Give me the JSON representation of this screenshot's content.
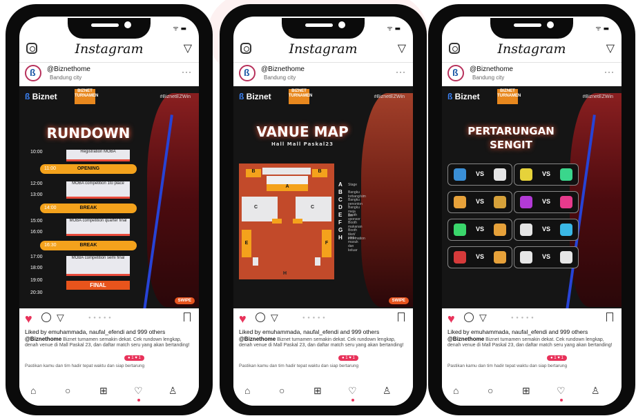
{
  "phones": [
    {
      "brand": "Instagram",
      "username": "@Biznethome",
      "location": "Bandung city",
      "post": {
        "logo": "Biznet",
        "tournament_badge": "BIZNET TURNAMEN",
        "hashtag": "#BiznetEZWin",
        "title": "RUNDOWN",
        "swipe": "SWIPE",
        "schedule": [
          {
            "time": "10:00",
            "label": "Registration MOBA",
            "kind": "box"
          },
          {
            "time": "11:00",
            "label": "OPENING",
            "kind": "bar"
          },
          {
            "time": "12:00",
            "label": "MOBA competition 1to place",
            "kind": "box"
          },
          {
            "time": "13:00",
            "label": "",
            "kind": "time"
          },
          {
            "time": "14:00",
            "label": "BREAK",
            "kind": "bar"
          },
          {
            "time": "15:00",
            "label": "MOBA competition quarter final",
            "kind": "box"
          },
          {
            "time": "16:00",
            "label": "",
            "kind": "time"
          },
          {
            "time": "16:30",
            "label": "BREAK",
            "kind": "bar"
          },
          {
            "time": "17:00",
            "label": "MOBA competition semi final",
            "kind": "box"
          },
          {
            "time": "18:00",
            "label": "",
            "kind": "time"
          },
          {
            "time": "19:00",
            "label": "",
            "kind": "time"
          },
          {
            "time": "20:30",
            "label": "FINAL",
            "kind": "final"
          }
        ]
      },
      "likes": "Liked by emuhammada, naufal_efendi and 999 others",
      "caption_user": "@Biznethome",
      "caption_text": "Biznet turnamen semakin dekat. Cek rundown lengkap, denah venue di Mall Paskal 23, dan daftar match seru yang akan bertanding!",
      "notif": "● 1  ♥  1",
      "comment": "Pastikan kamu dan tim hadir tepat waktu dan siap bertarung"
    },
    {
      "brand": "Instagram",
      "username": "@Biznethome",
      "location": "Bandung city",
      "post": {
        "logo": "Biznet",
        "tournament_badge": "BIZNET TURNAMEN",
        "hashtag": "#BiznetEZWin",
        "title": "VANUE MAP",
        "subtitle": "Hall Mall Paskal23",
        "swipe": "SWIPE",
        "legend": [
          {
            "key": "A",
            "text": "Stage"
          },
          {
            "key": "B",
            "text": "Bangku lorbang/sim"
          },
          {
            "key": "C",
            "text": "Bangku penonton"
          },
          {
            "key": "D",
            "text": "Bangku meja tim"
          },
          {
            "key": "E",
            "text": "Booth sponsor"
          },
          {
            "key": "F",
            "text": "Booth makanan"
          },
          {
            "key": "G",
            "text": "Booth tiket/ information"
          },
          {
            "key": "H",
            "text": "pintu masuk dan keluar"
          }
        ]
      },
      "likes": "Liked by emuhammada, naufal_efendi and 999 others",
      "caption_user": "@Biznethome",
      "caption_text": "Biznet turnamen semakin dekat. Cek rundown lengkap, denah venue di Mall Paskal 23, dan daftar match seru yang akan bertanding!",
      "notif": "● 1  ♥  1",
      "comment": "Pastikan kamu dan tim hadir tepat waktu dan siap bertarung"
    },
    {
      "brand": "Instagram",
      "username": "@Biznethome",
      "location": "Bandung city",
      "post": {
        "logo": "Biznet",
        "tournament_badge": "BIZNET TURNAMEN",
        "hashtag": "#BiznetEZWin",
        "title_line1": "PERTARUNGAN",
        "title_line2": "SENGIT",
        "matches": [
          {
            "vs": "VS",
            "left": "#3a8fd6",
            "right": "#e6e6e6"
          },
          {
            "vs": "VS",
            "left": "#e6d23a",
            "right": "#3ad68c"
          },
          {
            "vs": "VS",
            "left": "#e6a13a",
            "right": "#d6a13a"
          },
          {
            "vs": "VS",
            "left": "#b23ad6",
            "right": "#e63a8c"
          },
          {
            "vs": "VS",
            "left": "#3ad66b",
            "right": "#e6a13a"
          },
          {
            "vs": "VS",
            "left": "#e6e6e6",
            "right": "#3ab8e6"
          },
          {
            "vs": "VS",
            "left": "#d63a3a",
            "right": "#e6a13a"
          },
          {
            "vs": "VS",
            "left": "#e6e6e6",
            "right": "#e6e6e6"
          }
        ]
      },
      "likes": "Liked by emuhammada, naufal_efendi and 999 others",
      "caption_user": "@Biznethome",
      "caption_text": "Biznet turnamen semakin dekat. Cek rundown lengkap, denah venue di Mall Paskal 23, dan daftar match seru yang akan bertanding!",
      "notif": "● 1  ♥  1",
      "comment": "Pastikan kamu dan tim hadir tepat waktu dan siap bertarung"
    }
  ],
  "icons": {
    "camera": "camera-icon",
    "send": "send-icon",
    "more": "more-icon",
    "heart": "heart-icon",
    "comment": "comment-icon",
    "share": "share-icon",
    "bookmark": "bookmark-icon",
    "home": "home-icon",
    "search": "search-icon",
    "add": "add-icon",
    "activity": "heart-icon",
    "profile": "profile-icon"
  }
}
